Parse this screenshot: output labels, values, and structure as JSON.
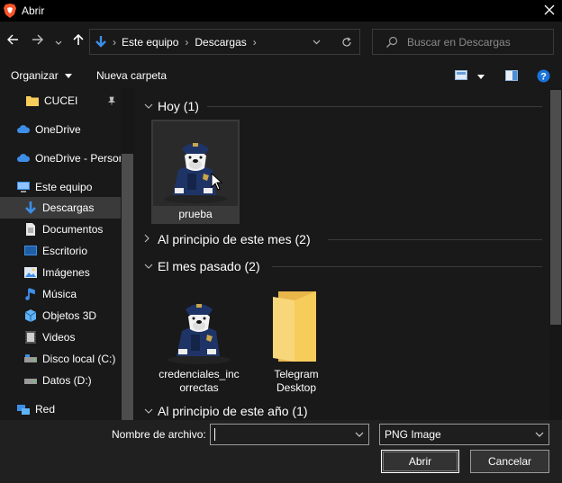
{
  "window": {
    "title": "Abrir",
    "close_icon": "close-icon"
  },
  "nav": {
    "breadcrumb": [
      "Este equipo",
      "Descargas"
    ],
    "search_placeholder": "Buscar en Descargas"
  },
  "toolbar": {
    "organize": "Organizar",
    "new_folder": "Nueva carpeta"
  },
  "sidebar": {
    "items": [
      {
        "label": "CUCEI",
        "icon": "folder-icon"
      },
      {
        "label": "OneDrive",
        "icon": "cloud-icon"
      },
      {
        "label": "OneDrive - Person",
        "icon": "cloud-icon"
      },
      {
        "label": "Este equipo",
        "icon": "computer-icon"
      },
      {
        "label": "Descargas",
        "icon": "download-icon"
      },
      {
        "label": "Documentos",
        "icon": "document-icon"
      },
      {
        "label": "Escritorio",
        "icon": "desktop-icon"
      },
      {
        "label": "Imágenes",
        "icon": "pictures-icon"
      },
      {
        "label": "Música",
        "icon": "music-icon"
      },
      {
        "label": "Objetos 3D",
        "icon": "cube-icon"
      },
      {
        "label": "Videos",
        "icon": "video-icon"
      },
      {
        "label": "Disco local (C:)",
        "icon": "drive-icon"
      },
      {
        "label": "Datos (D:)",
        "icon": "drive-icon"
      },
      {
        "label": "Red",
        "icon": "network-icon"
      }
    ]
  },
  "content": {
    "groups": [
      {
        "label": "Hoy (1)"
      },
      {
        "label": "Al principio de este mes (2)"
      },
      {
        "label": "El mes pasado (2)"
      },
      {
        "label": "Al principio de este año (1)"
      }
    ],
    "files": [
      {
        "name": "prueba",
        "type": "image"
      },
      {
        "name": "credenciales_incorrectas",
        "line1": "credenciales_inc",
        "line2": "orrectas",
        "type": "image"
      },
      {
        "name": "Telegram Desktop",
        "line1": "Telegram",
        "line2": "Desktop",
        "type": "folder"
      }
    ]
  },
  "footer": {
    "filename_label": "Nombre de archivo:",
    "filename_value": "",
    "filetype": "PNG Image",
    "open": "Abrir",
    "cancel": "Cancelar"
  },
  "colors": {
    "accent": "#0078d7",
    "folder": "#f6cc5b",
    "selection": "#3a3a3a"
  }
}
